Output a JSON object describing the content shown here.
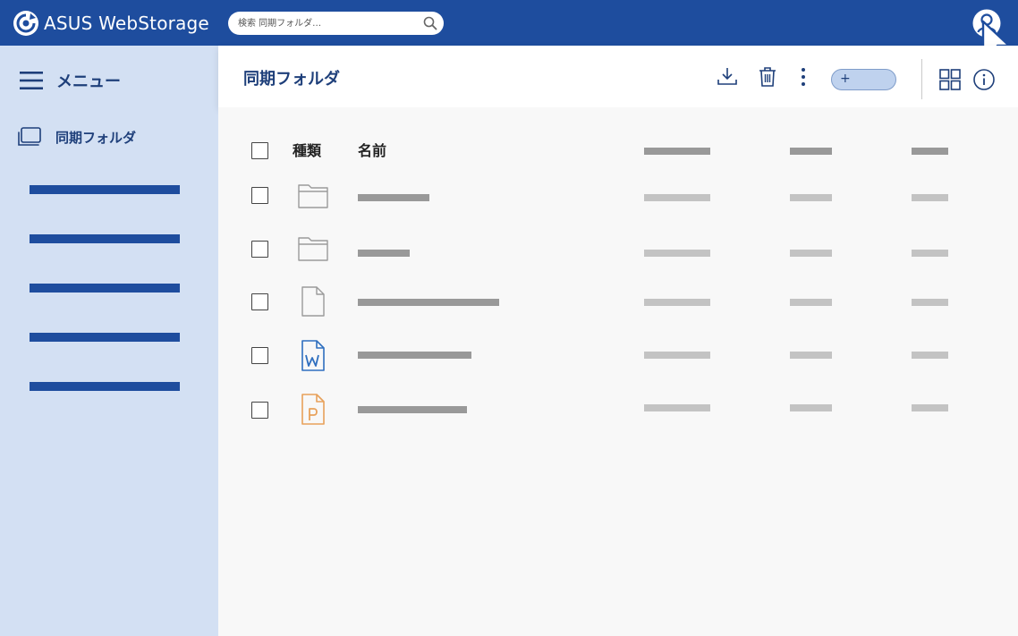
{
  "brand": {
    "name": "ASUS WebStorage",
    "color": "#1e4d9e"
  },
  "search": {
    "placeholder": "検索 同期フォルダ…",
    "icon": "search-icon"
  },
  "header_icons": {
    "user": "user-icon",
    "cursor": "mouse-pointer-icon"
  },
  "sidebar": {
    "menu_label": "メニュー",
    "active_item": {
      "label": "同期フォルダ",
      "icon": "sync-folder-icon"
    },
    "placeholder_items": 5
  },
  "toolbar": {
    "title": "同期フォルダ",
    "icons": [
      "download-icon",
      "trash-icon",
      "more-vertical-icon",
      "grid-view-icon",
      "info-icon"
    ],
    "add_button_label": "+"
  },
  "table": {
    "columns": {
      "type": "種類",
      "name": "名前"
    },
    "rows": [
      {
        "kind": "folder"
      },
      {
        "kind": "folder"
      },
      {
        "kind": "file"
      },
      {
        "kind": "word"
      },
      {
        "kind": "powerpoint"
      }
    ]
  },
  "colors": {
    "topbar": "#1e4d9e",
    "sidebar": "#d3e0f3",
    "accent_text": "#1e3f7a",
    "word": "#2f6fbf",
    "powerpoint": "#e8a15a"
  }
}
